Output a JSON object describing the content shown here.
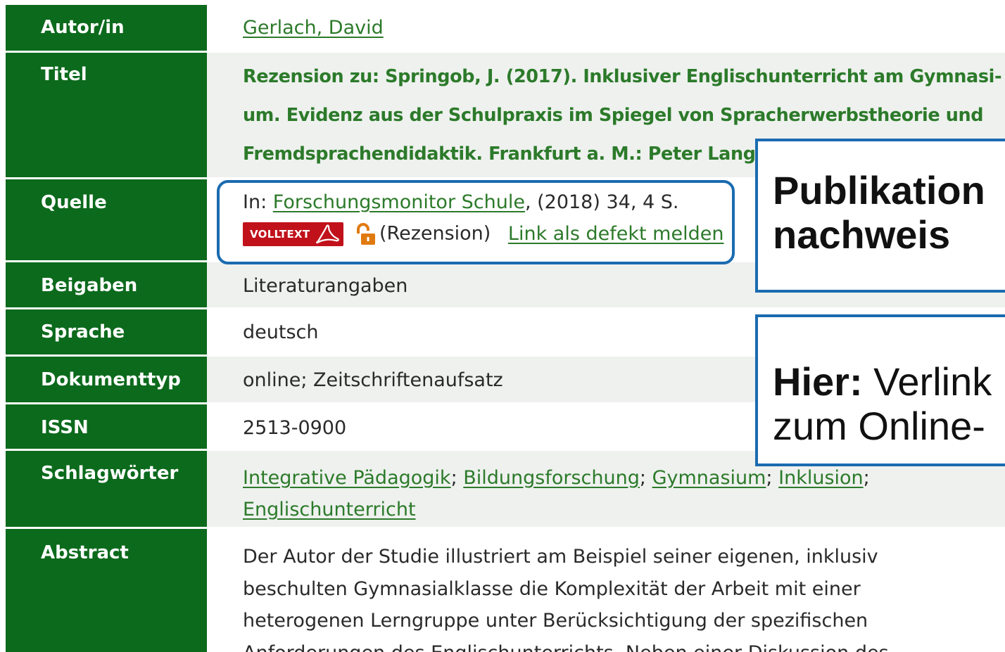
{
  "fields": {
    "autor": {
      "label": "Autor/in",
      "value": "Gerlach, David"
    },
    "titel": {
      "label": "Titel",
      "lines": [
        "Rezension zu: Springob, J. (2017). Inklusiver Englischunterricht am Gymnasi-",
        "um. Evidenz aus der Schulpraxis im Spiegel von Spracherwerbstheorie und",
        "Fremdsprachendidaktik. Frankfurt a. M.: Peter Lang."
      ]
    },
    "quelle": {
      "label": "Quelle",
      "prefix": "In: ",
      "journal": "Forschungsmonitor Schule",
      "suffix": ", (2018) 34, 4 S.",
      "volltext_badge": "VOLLTEXT",
      "rezension": "(Rezension)",
      "defect_link": "Link als defekt melden"
    },
    "beigaben": {
      "label": "Beigaben",
      "value": "Literaturangaben"
    },
    "sprache": {
      "label": "Sprache",
      "value": "deutsch"
    },
    "dokumenttyp": {
      "label": "Dokumenttyp",
      "value": "online; Zeitschriftenaufsatz"
    },
    "issn": {
      "label": "ISSN",
      "value": "2513-0900"
    },
    "schlagwoerter": {
      "label": "Schlagwörter",
      "keywords": [
        "Integrative Pädagogik",
        "Bildungsforschung",
        "Gymnasium",
        "Inklusion",
        "Englischunterricht"
      ],
      "separator": ";"
    },
    "abstract": {
      "label": "Abstract",
      "lines": [
        "Der Autor der Studie illustriert am Beispiel seiner eigenen, inklusiv",
        "beschulten Gymnasialklasse die Komplexität der Arbeit mit einer",
        "heterogenen Lerngruppe unter Berücksichtigung der spezifischen",
        "Anforderungen des Englischunterrichts. Neben einer Diskussion des"
      ]
    }
  },
  "callouts": {
    "publikation": {
      "line1": "Publikation",
      "line2": "nachweis"
    },
    "hier": {
      "bold": "Hier:",
      "rest": " Verlink",
      "line2": "zum Online-"
    }
  },
  "colors": {
    "label_bg": "#0c6a1c",
    "link": "#2c7a2a",
    "accent_border": "#1a6bb0",
    "volltext_red": "#c1121b",
    "lock_orange": "#e07a10"
  }
}
